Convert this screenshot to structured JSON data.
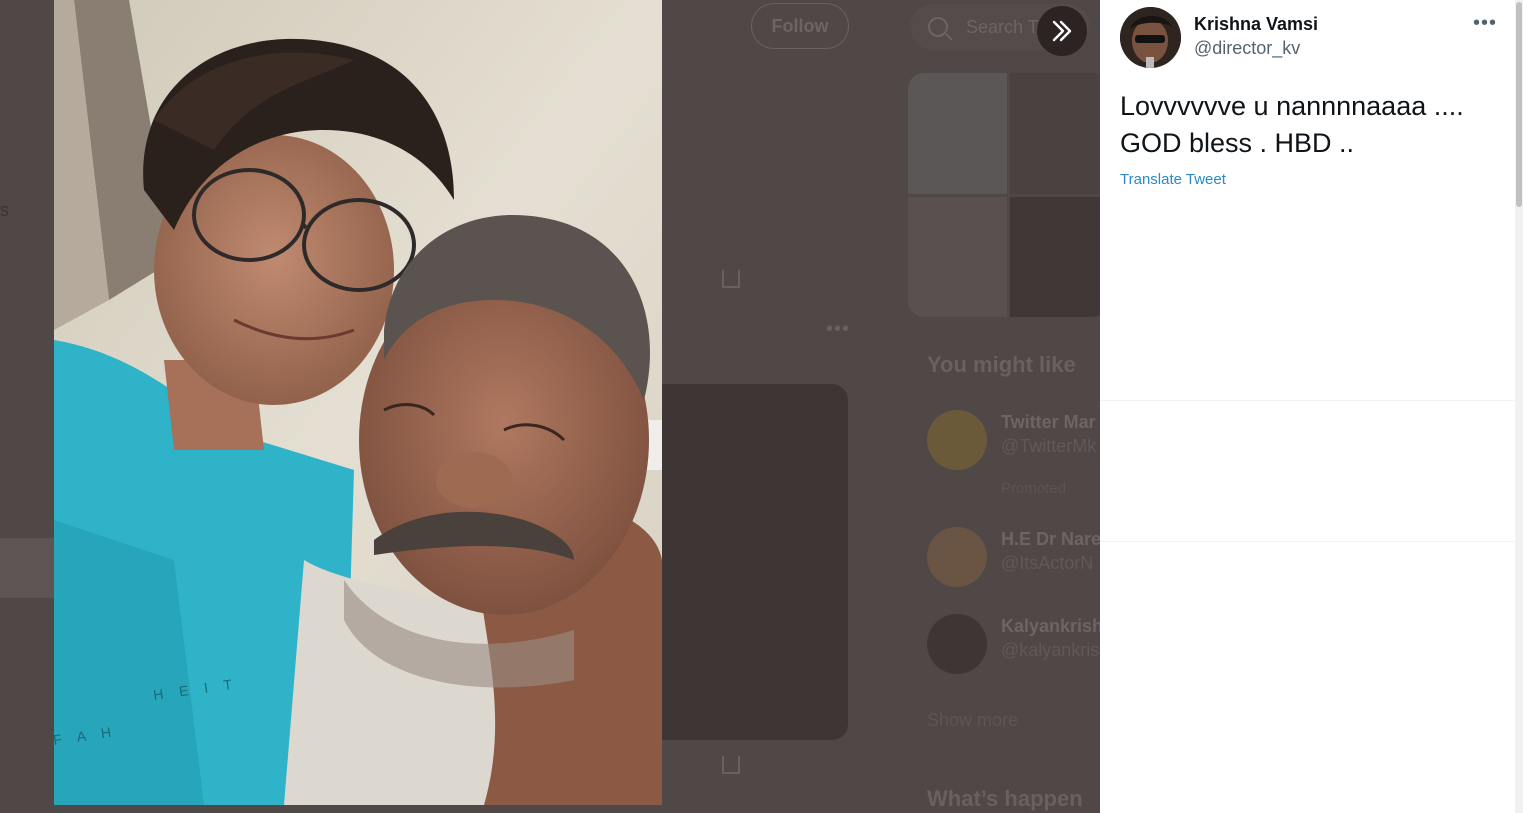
{
  "background": {
    "follow_label": "Follow",
    "search_placeholder": "Search T",
    "side_text": "s",
    "you_might_like": "You might like",
    "whats_happening": "What’s happen",
    "show_more": "Show more",
    "suggestions": [
      {
        "name": "Twitter Mar",
        "handle": "@TwitterMk",
        "promoted": "Promoted"
      },
      {
        "name": "H.E Dr Nare",
        "handle": "@ItsActorN"
      },
      {
        "name": "Kalyankrish",
        "handle": "@kalyankris"
      }
    ]
  },
  "tweet": {
    "author_name": "Krishna Vamsi",
    "author_handle": "@director_kv",
    "text": "Lovvvvvve u nannnnaaaa .... GOD bless . HBD ..",
    "translate_label": "Translate Tweet"
  },
  "icons": [
    "next-arrow-icon",
    "more-icon",
    "search-icon",
    "share-icon"
  ],
  "colors": {
    "link": "#2a89c9",
    "text": "#0f1419",
    "secondary": "#536471",
    "overlay": "#4f4847"
  }
}
